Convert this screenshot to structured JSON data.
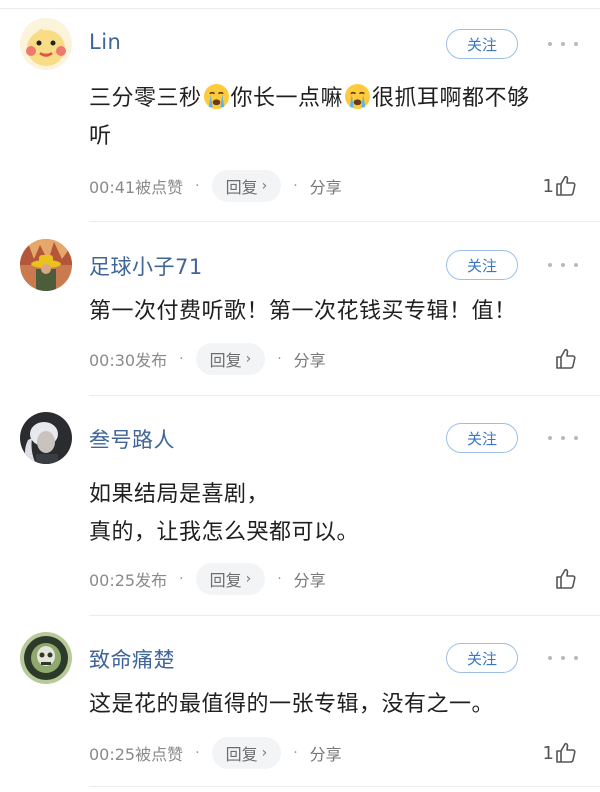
{
  "comments": [
    {
      "username": "Lin",
      "follow_label": "关注",
      "text_parts": [
        "三分零三秒",
        "你长一点嘛",
        "很抓耳啊都不够\n听"
      ],
      "emojis": [
        "crying-face-icon",
        "crying-face-icon"
      ],
      "time": "00:41被点赞",
      "reply_label": "回复",
      "share_label": "分享",
      "likes": "1"
    },
    {
      "username": "足球小子71",
      "follow_label": "关注",
      "text": "第一次付费听歌！第一次花钱买专辑！值！",
      "time": "00:30发布",
      "reply_label": "回复",
      "share_label": "分享",
      "likes": ""
    },
    {
      "username": "叁号路人",
      "follow_label": "关注",
      "text": "如果结局是喜剧，\n真的，让我怎么哭都可以。",
      "time": "00:25发布",
      "reply_label": "回复",
      "share_label": "分享",
      "likes": ""
    },
    {
      "username": "致命痛楚",
      "follow_label": "关注",
      "text": "这是花的最值得的一张专辑，没有之一。",
      "time": "00:25被点赞",
      "reply_label": "回复",
      "share_label": "分享",
      "likes": "1"
    }
  ],
  "colors": {
    "username": "#406599",
    "follow_border": "#9cc0e8",
    "follow_text": "#3b76c4"
  }
}
